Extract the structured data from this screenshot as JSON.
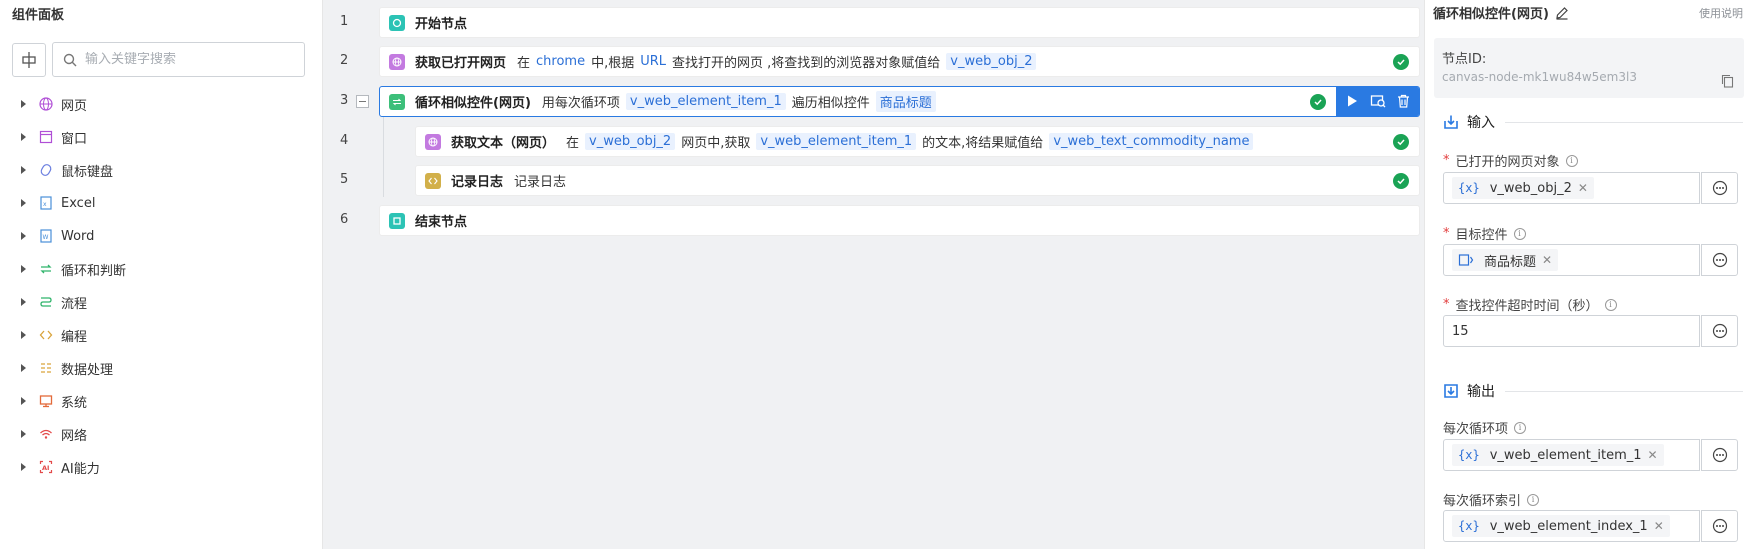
{
  "left_panel": {
    "title": "组件面板",
    "search_placeholder": "输入关键字搜索",
    "categories": [
      {
        "label": "网页",
        "icon": "globe-icon"
      },
      {
        "label": "窗口",
        "icon": "window-icon"
      },
      {
        "label": "鼠标键盘",
        "icon": "mouse-icon"
      },
      {
        "label": "Excel",
        "icon": "excel-icon"
      },
      {
        "label": "Word",
        "icon": "word-icon"
      },
      {
        "label": "循环和判断",
        "icon": "loop-icon"
      },
      {
        "label": "流程",
        "icon": "flow-icon"
      },
      {
        "label": "编程",
        "icon": "code-icon"
      },
      {
        "label": "数据处理",
        "icon": "data-icon"
      },
      {
        "label": "系统",
        "icon": "monitor-icon"
      },
      {
        "label": "网络",
        "icon": "wifi-icon"
      },
      {
        "label": "AI能力",
        "icon": "ai-icon"
      }
    ]
  },
  "canvas": {
    "nodes": [
      {
        "line": "1",
        "title": "开始节点"
      },
      {
        "line": "2",
        "title": "获取已打开网页",
        "t1": "在",
        "v1": "chrome",
        "t2": "中,根据",
        "v2": "URL",
        "t3": "查找打开的网页 ,将查找到的浏览器对象赋值给",
        "c1": "v_web_obj_2"
      },
      {
        "line": "3",
        "title": "循环相似控件(网页)",
        "t1": "用每次循环项",
        "c1": "v_web_element_item_1",
        "t2": "遍历相似控件",
        "c2": "商品标题"
      },
      {
        "line": "4",
        "title": "获取文本（网页）",
        "t1": "在",
        "c1": "v_web_obj_2",
        "t2": "网页中,获取",
        "c2": "v_web_element_item_1",
        "t3": "的文本,将结果赋值给",
        "c3": "v_web_text_commodity_name"
      },
      {
        "line": "5",
        "title": "记录日志",
        "t1": "记录日志"
      },
      {
        "line": "6",
        "title": "结束节点"
      }
    ]
  },
  "right_panel": {
    "title": "循环相似控件(网页)",
    "help": "使用说明",
    "node_id_label": "节点ID:",
    "node_id_value": "canvas-node-mk1wu84w5em3l3",
    "input_section": "输入",
    "output_section": "输出",
    "fields": {
      "web_obj_label": "已打开的网页对象",
      "web_obj_value": "v_web_obj_2",
      "target_label": "目标控件",
      "target_value": "商品标题",
      "timeout_label": "查找控件超时时间（秒）",
      "timeout_value": "15",
      "loop_item_label": "每次循环项",
      "loop_item_value": "v_web_element_item_1",
      "loop_index_label": "每次循环索引",
      "loop_index_value": "v_web_element_index_1"
    },
    "var_icon_text": "{x}",
    "required_mark": "*"
  },
  "colors": {
    "accent": "#2a7ae2",
    "success": "#1aa355",
    "variable": "#2b6fd6",
    "required": "#e23c3c"
  }
}
